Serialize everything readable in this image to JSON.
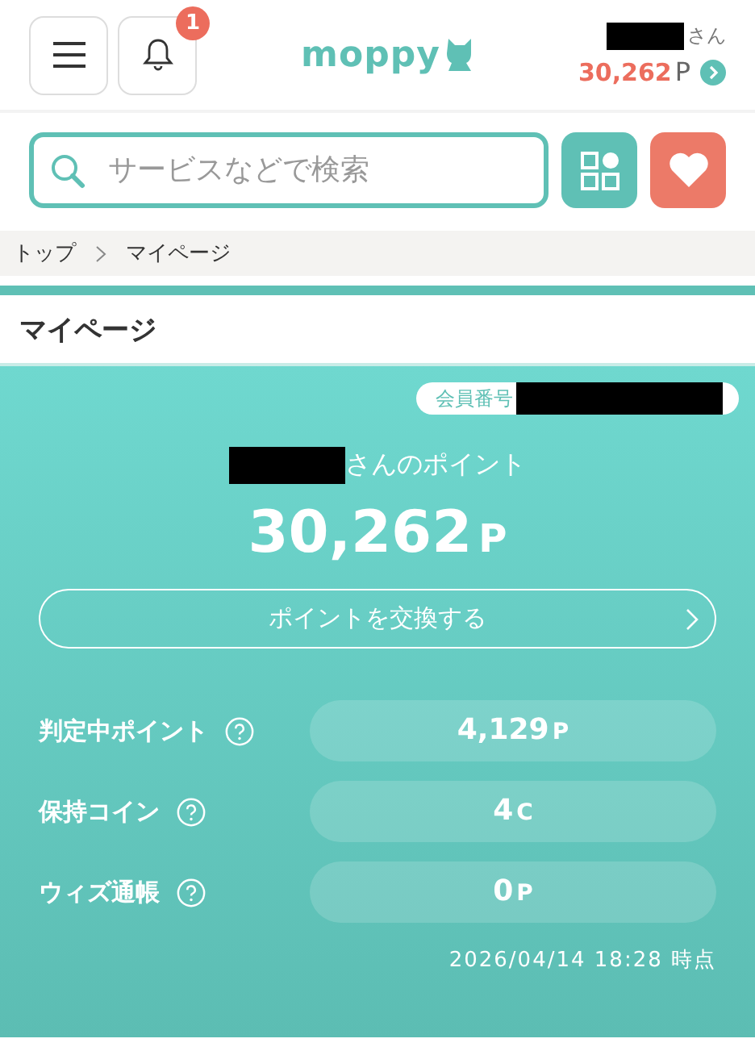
{
  "header": {
    "notification_count": "1",
    "logo": "moppy",
    "user": {
      "name_redacted": true,
      "suffix": "さん",
      "points": "30,262",
      "unit": "P"
    }
  },
  "search": {
    "placeholder": "サービスなどで検索"
  },
  "breadcrumb": [
    "トップ",
    "マイページ"
  ],
  "page_title": "マイページ",
  "summary": {
    "member_label": "会員番号",
    "member_redacted": true,
    "owner_redacted": true,
    "owner_suffix": "さんのポイント",
    "points": "30,262",
    "unit": "P",
    "exchange_button": "ポイントを交換する",
    "rows": [
      {
        "label": "判定中ポイント",
        "value": "4,129",
        "unit": "P"
      },
      {
        "label": "保持コイン",
        "value": "4",
        "unit": "C"
      },
      {
        "label": "ウィズ通帳",
        "value": "0",
        "unit": "P"
      }
    ],
    "as_of": "2026/04/14 18:28 時点"
  }
}
